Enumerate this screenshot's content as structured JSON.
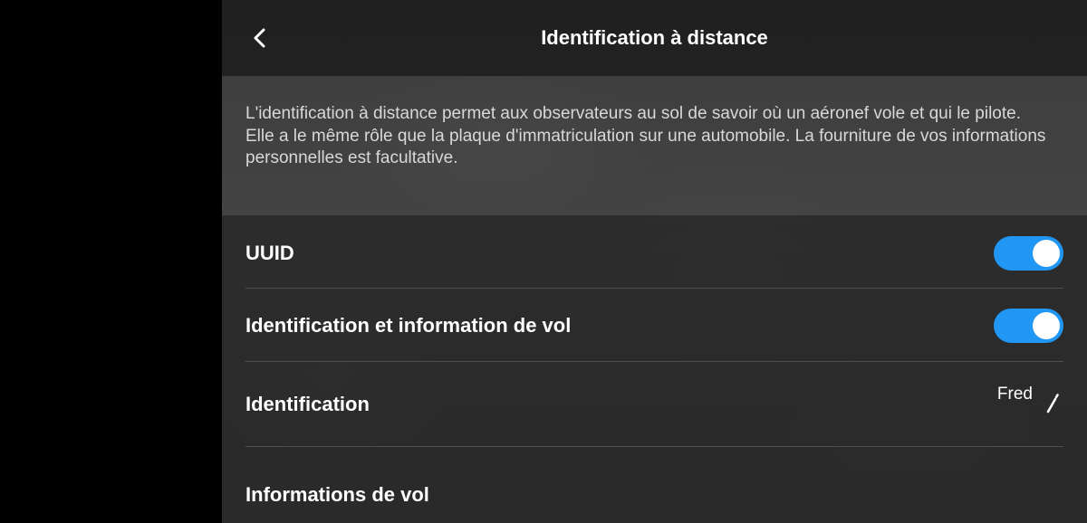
{
  "header": {
    "title": "Identification à distance"
  },
  "description": "L'identification à distance permet aux observateurs au sol de savoir où un aéronef vole et qui le pilote. Elle a le même rôle que la plaque d'immatriculation sur une automobile. La fourniture de vos informations personnelles est facultative.",
  "settings": [
    {
      "label": "UUID",
      "type": "toggle",
      "enabled": true
    },
    {
      "label": "Identification et information de vol",
      "type": "toggle",
      "enabled": true
    },
    {
      "label": "Identification",
      "type": "value",
      "value": "Fred",
      "icon": "pencil-icon"
    },
    {
      "label": "Informations de vol",
      "type": "nav"
    }
  ],
  "colors": {
    "accent": "#2196f3",
    "text": "#ffffff",
    "description_text": "#d8d8d8",
    "background": "#000000"
  }
}
